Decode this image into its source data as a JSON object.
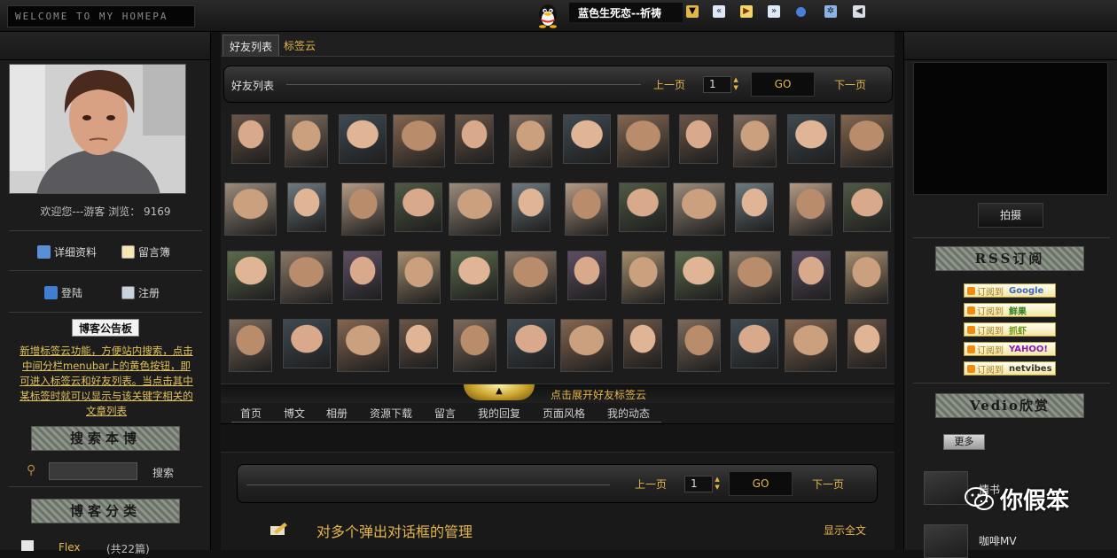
{
  "header": {
    "logo_text": "WELCOME TO MY HOMEPA",
    "music_title": "蓝色生死恋--祈祷"
  },
  "profile": {
    "welcome": "欢迎您---游客   浏览： 9169",
    "links": {
      "details": "详细资料",
      "guestbook": "留言簿",
      "login": "登陆",
      "register": "注册"
    },
    "notice_title": "博客公告板",
    "notice_body": "新增标签云功能，方便站内搜索，点击中间分栏menubar上的黄色按钮，即可进入标签云和好友列表。当点击其中某标签时就可以显示与该关键字相关的文章列表",
    "search_banner": "搜索本博",
    "search_button": "搜索",
    "category_banner": "博客分类",
    "category_item": "Flex",
    "category_count": "(共22篇)"
  },
  "center": {
    "tabs": [
      "好友列表",
      "标签云"
    ],
    "friend_header_title": "好友列表",
    "pager": {
      "prev": "上一页",
      "page": "1",
      "go": "GO",
      "next": "下一页"
    },
    "expand_text": "点击展开好友标签云",
    "nav": [
      "首页",
      "博文",
      "相册",
      "资源下载",
      "留言",
      "我的回复",
      "页面风格",
      "我的动态"
    ],
    "post_title": "对多个弹出对话框的管理",
    "show_all": "显示全文"
  },
  "right": {
    "shoot_button": "拍摄",
    "rss_banner": "RSS订阅",
    "rss_prefix": "订阅到",
    "rss_items": [
      "Google",
      "鲜果",
      "抓虾",
      "YAHOO!",
      "netvibes"
    ],
    "video_banner": "Vedio欣赏",
    "more_button": "更多",
    "videos": [
      "情书",
      "咖啡MV"
    ],
    "watermark": "你假笨"
  },
  "colors": {
    "accent": "#e5b64a",
    "background": "#121212",
    "panel": "#1c1c1c"
  }
}
